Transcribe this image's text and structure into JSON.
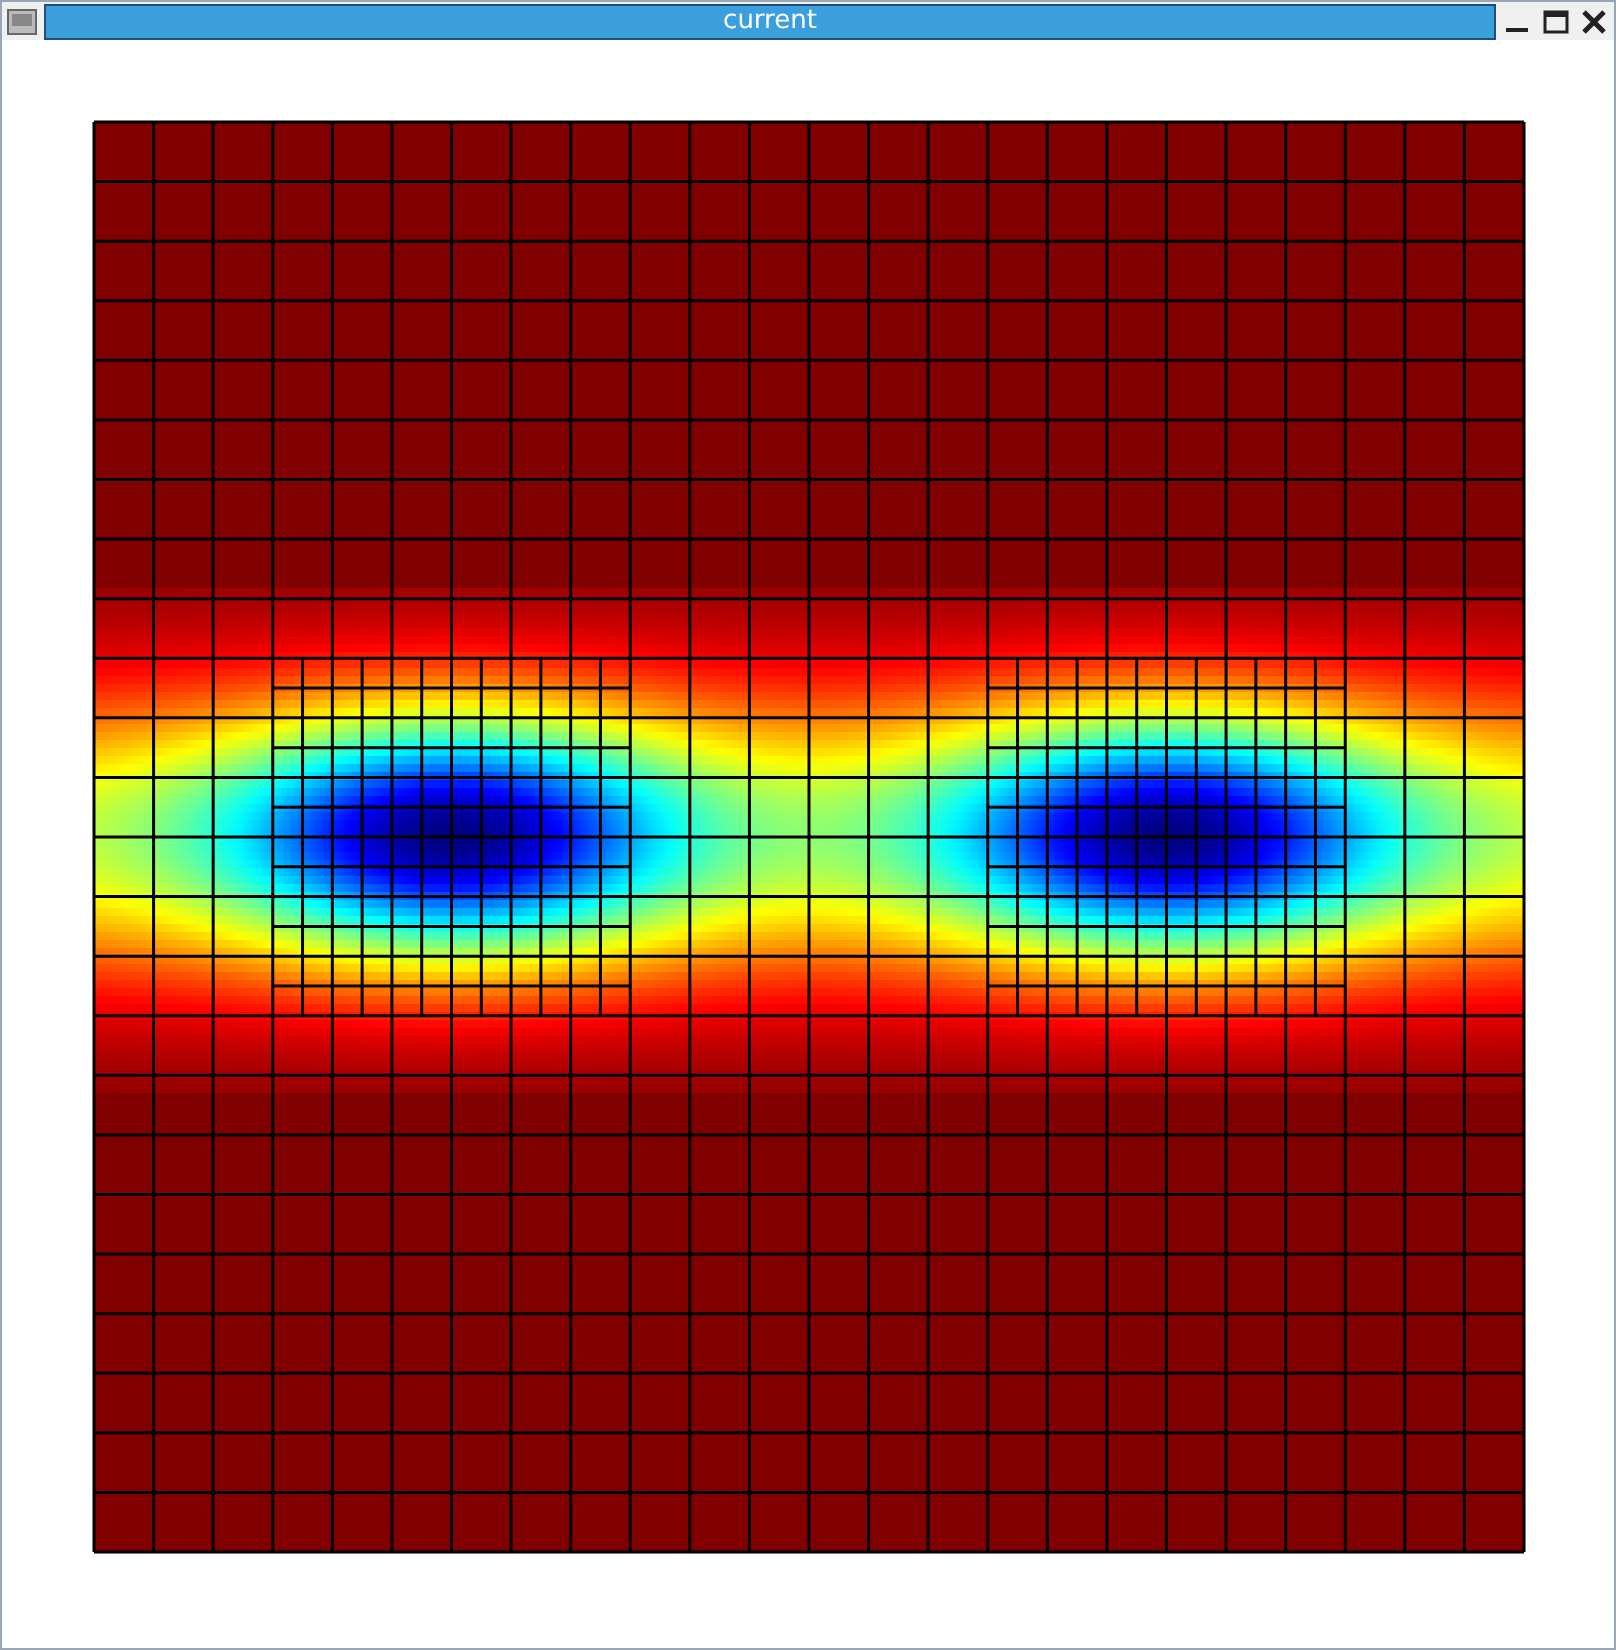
{
  "window": {
    "title": "current"
  }
}
